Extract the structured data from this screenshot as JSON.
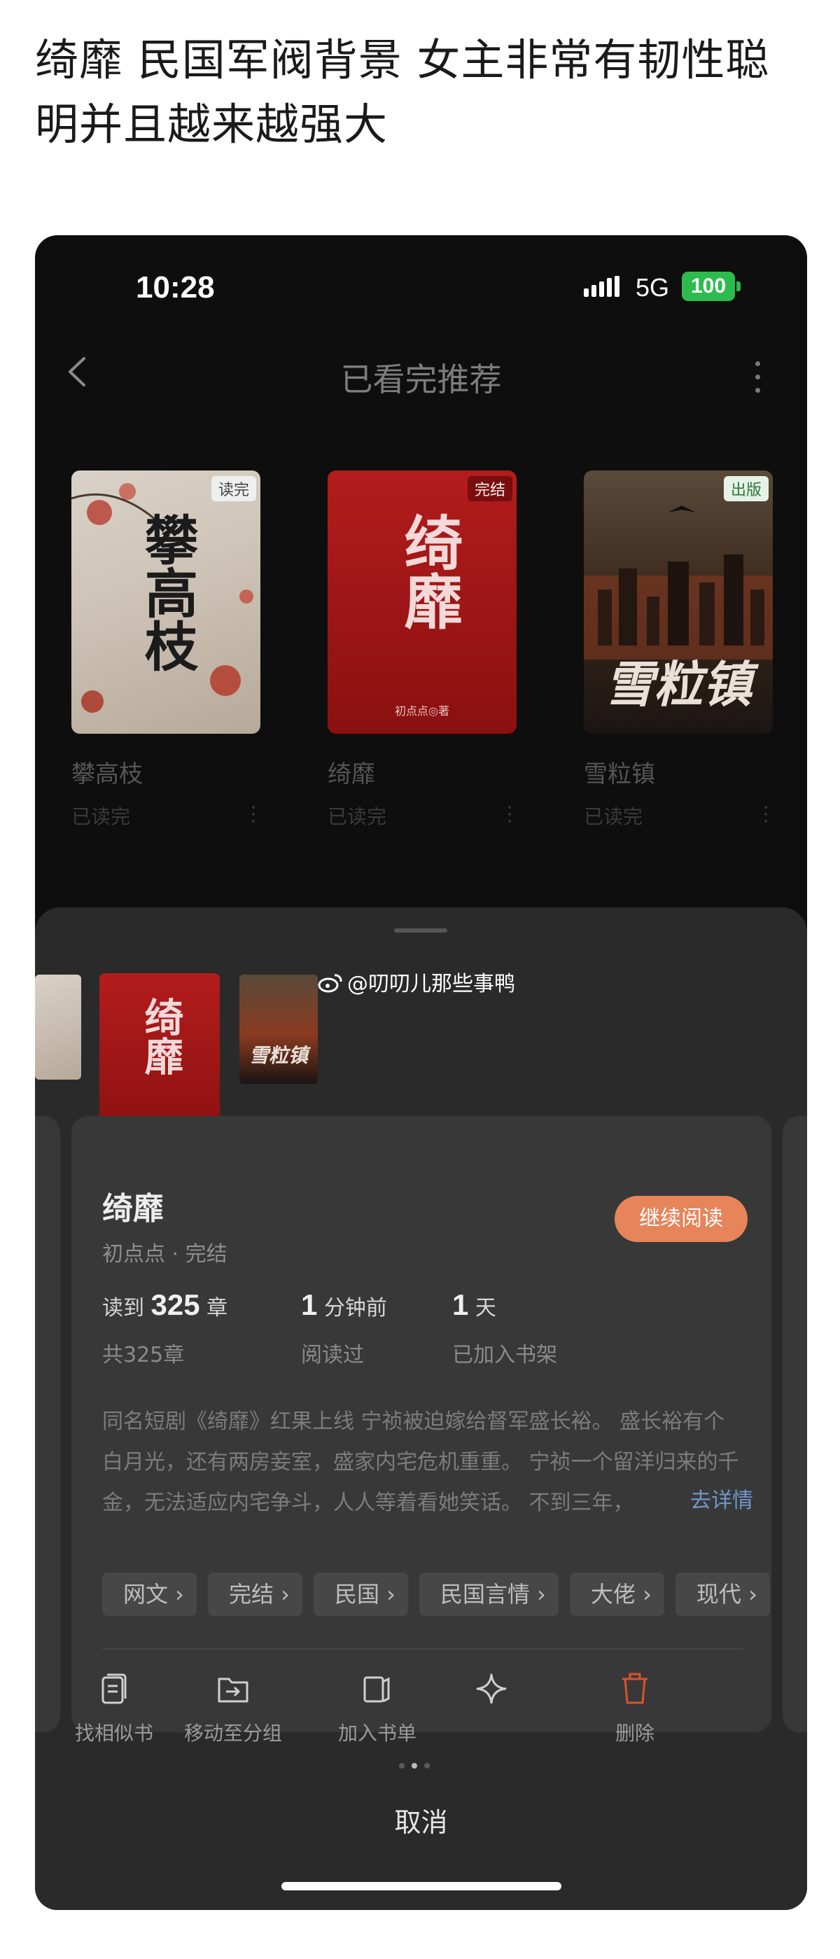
{
  "post": {
    "title": "绮靡 民国军阀背景 女主非常有韧性聪明并且越来越强大"
  },
  "status_bar": {
    "time": "10:28",
    "network": "5G",
    "battery": "100"
  },
  "header": {
    "title": "已看完推荐"
  },
  "books": [
    {
      "title": "攀高枝",
      "status": "已读完",
      "badge": "读完",
      "cover_text": "攀高枝"
    },
    {
      "title": "绮靡",
      "status": "已读完",
      "badge": "完结",
      "cover_text": "绮靡",
      "cover_author": "初点点◎著"
    },
    {
      "title": "雪粒镇",
      "status": "已读完",
      "badge": "出版",
      "cover_text": "雪粒镇"
    }
  ],
  "sheet": {
    "watermark": "@叨叨儿那些事鸭",
    "card": {
      "title": "绮靡",
      "subtitle": "初点点 · 完结",
      "continue_label": "继续阅读",
      "stats": [
        {
          "prefix": "读到",
          "value": "325",
          "suffix": "章",
          "label": "共325章"
        },
        {
          "prefix": "",
          "value": "1",
          "suffix": "分钟前",
          "label": "阅读过"
        },
        {
          "prefix": "",
          "value": "1",
          "suffix": "天",
          "label": "已加入书架"
        }
      ],
      "description": "同名短剧《绮靡》红果上线 宁祯被迫嫁给督军盛长裕。 盛长裕有个白月光，还有两房妾室，盛家内宅危机重重。 宁祯一个留洋归来的千金，无法适应内宅争斗，人人等着看她笑话。 不到三年，",
      "detail_link": "去详情",
      "tags": [
        "网文 ›",
        "完结 ›",
        "民国 ›",
        "民国言情 ›",
        "大佬 ›",
        "现代 ›"
      ],
      "actions": [
        {
          "label": "找相似书",
          "icon": "similar-book-icon"
        },
        {
          "label": "移动至分组",
          "icon": "move-folder-icon"
        },
        {
          "label": "加入书单",
          "icon": "booklist-icon"
        },
        {
          "label": "",
          "icon": "sparkle-icon"
        },
        {
          "label": "删除",
          "icon": "trash-icon"
        }
      ]
    },
    "cancel_label": "取消"
  },
  "colors": {
    "accent": "#e6845a",
    "delete": "#d9532b",
    "link": "#6f97c9",
    "battery": "#2dbb4d"
  }
}
